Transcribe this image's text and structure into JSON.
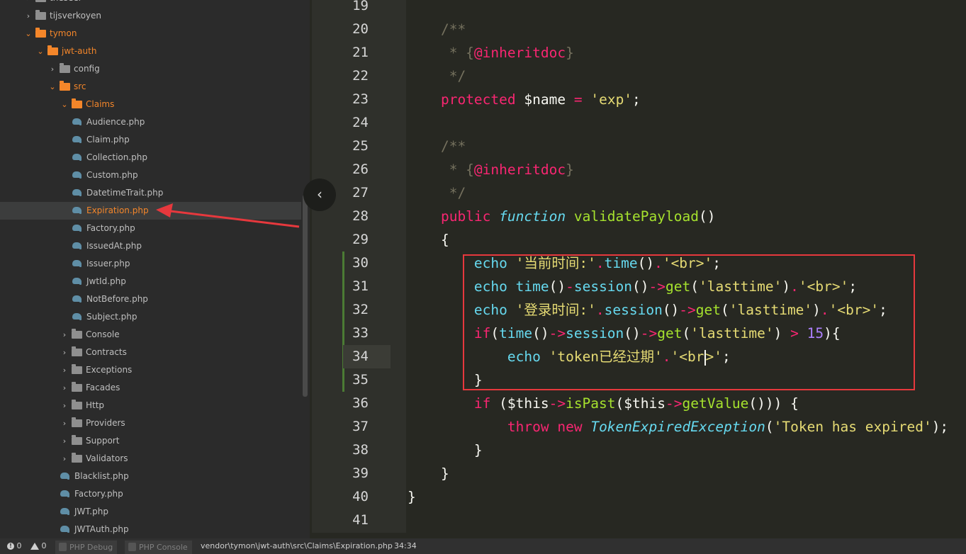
{
  "tree": [
    {
      "name": "theseer",
      "kind": "folder",
      "state": "closed",
      "depth": 1
    },
    {
      "name": "tijsverkoyen",
      "kind": "folder",
      "state": "closed",
      "depth": 1
    },
    {
      "name": "tymon",
      "kind": "folder",
      "state": "open",
      "depth": 1
    },
    {
      "name": "jwt-auth",
      "kind": "folder",
      "state": "open",
      "depth": 2
    },
    {
      "name": "config",
      "kind": "folder",
      "state": "closed",
      "depth": 3
    },
    {
      "name": "src",
      "kind": "folder",
      "state": "open",
      "depth": 3
    },
    {
      "name": "Claims",
      "kind": "folder",
      "state": "open",
      "depth": 4
    },
    {
      "name": "Audience.php",
      "kind": "file",
      "depth": 5
    },
    {
      "name": "Claim.php",
      "kind": "file",
      "depth": 5
    },
    {
      "name": "Collection.php",
      "kind": "file",
      "depth": 5
    },
    {
      "name": "Custom.php",
      "kind": "file",
      "depth": 5
    },
    {
      "name": "DatetimeTrait.php",
      "kind": "file",
      "depth": 5
    },
    {
      "name": "Expiration.php",
      "kind": "file",
      "depth": 5,
      "selected": true
    },
    {
      "name": "Factory.php",
      "kind": "file",
      "depth": 5
    },
    {
      "name": "IssuedAt.php",
      "kind": "file",
      "depth": 5
    },
    {
      "name": "Issuer.php",
      "kind": "file",
      "depth": 5
    },
    {
      "name": "JwtId.php",
      "kind": "file",
      "depth": 5
    },
    {
      "name": "NotBefore.php",
      "kind": "file",
      "depth": 5
    },
    {
      "name": "Subject.php",
      "kind": "file",
      "depth": 5
    },
    {
      "name": "Console",
      "kind": "folder",
      "state": "closed",
      "depth": 4
    },
    {
      "name": "Contracts",
      "kind": "folder",
      "state": "closed",
      "depth": 4
    },
    {
      "name": "Exceptions",
      "kind": "folder",
      "state": "closed",
      "depth": 4
    },
    {
      "name": "Facades",
      "kind": "folder",
      "state": "closed",
      "depth": 4
    },
    {
      "name": "Http",
      "kind": "folder",
      "state": "closed",
      "depth": 4
    },
    {
      "name": "Providers",
      "kind": "folder",
      "state": "closed",
      "depth": 4
    },
    {
      "name": "Support",
      "kind": "folder",
      "state": "closed",
      "depth": 4
    },
    {
      "name": "Validators",
      "kind": "folder",
      "state": "closed",
      "depth": 4
    },
    {
      "name": "Blacklist.php",
      "kind": "file",
      "depth": 4
    },
    {
      "name": "Factory.php",
      "kind": "file",
      "depth": 4
    },
    {
      "name": "JWT.php",
      "kind": "file",
      "depth": 4
    },
    {
      "name": "JWTAuth.php",
      "kind": "file",
      "depth": 4
    }
  ],
  "editor": {
    "collapse_icon": "chevron-left-icon",
    "first_line_number": 19,
    "lines": [
      [],
      [
        [
          "    ",
          ""
        ],
        [
          "/**",
          "cm"
        ]
      ],
      [
        [
          "     * {",
          "cm"
        ],
        [
          "@inheritdoc",
          "kw"
        ],
        [
          "}",
          "cm"
        ]
      ],
      [
        [
          "     */",
          "cm"
        ]
      ],
      [
        [
          "    ",
          ""
        ],
        [
          "protected",
          "kw"
        ],
        [
          " ",
          ""
        ],
        [
          "$name",
          "va"
        ],
        [
          " ",
          ""
        ],
        [
          "=",
          "kw"
        ],
        [
          " ",
          ""
        ],
        [
          "'exp'",
          "st"
        ],
        [
          ";",
          ""
        ]
      ],
      [],
      [
        [
          "    ",
          ""
        ],
        [
          "/**",
          "cm"
        ]
      ],
      [
        [
          "     * {",
          "cm"
        ],
        [
          "@inheritdoc",
          "kw"
        ],
        [
          "}",
          "cm"
        ]
      ],
      [
        [
          "     */",
          "cm"
        ]
      ],
      [
        [
          "    ",
          ""
        ],
        [
          "public",
          "kw"
        ],
        [
          " ",
          ""
        ],
        [
          "function",
          "fnk"
        ],
        [
          " ",
          ""
        ],
        [
          "validatePayload",
          "fn"
        ],
        [
          "()",
          ""
        ]
      ],
      [
        [
          "    {",
          ""
        ]
      ],
      [
        [
          "        ",
          ""
        ],
        [
          "echo",
          "ec"
        ],
        [
          " ",
          ""
        ],
        [
          "'当前时间:'",
          "st"
        ],
        [
          ".",
          "kw"
        ],
        [
          "time",
          "ec"
        ],
        [
          "()",
          ""
        ],
        [
          ".",
          "kw"
        ],
        [
          "'<br>'",
          "st"
        ],
        [
          ";",
          ""
        ]
      ],
      [
        [
          "        ",
          ""
        ],
        [
          "echo",
          "ec"
        ],
        [
          " ",
          ""
        ],
        [
          "time",
          "ec"
        ],
        [
          "()",
          ""
        ],
        [
          "-",
          "kw"
        ],
        [
          "session",
          "ec"
        ],
        [
          "()",
          ""
        ],
        [
          "->",
          "kw"
        ],
        [
          "get",
          "fn"
        ],
        [
          "(",
          ""
        ],
        [
          "'lasttime'",
          "st"
        ],
        [
          ")",
          ""
        ],
        [
          ".",
          "kw"
        ],
        [
          "'<br>'",
          "st"
        ],
        [
          ";",
          ""
        ]
      ],
      [
        [
          "        ",
          ""
        ],
        [
          "echo",
          "ec"
        ],
        [
          " ",
          ""
        ],
        [
          "'登录时间:'",
          "st"
        ],
        [
          ".",
          "kw"
        ],
        [
          "session",
          "ec"
        ],
        [
          "()",
          ""
        ],
        [
          "->",
          "kw"
        ],
        [
          "get",
          "fn"
        ],
        [
          "(",
          ""
        ],
        [
          "'lasttime'",
          "st"
        ],
        [
          ")",
          ""
        ],
        [
          ".",
          "kw"
        ],
        [
          "'<br>'",
          "st"
        ],
        [
          ";",
          ""
        ]
      ],
      [
        [
          "        ",
          ""
        ],
        [
          "if",
          "kw"
        ],
        [
          "(",
          ""
        ],
        [
          "time",
          "ec"
        ],
        [
          "()",
          ""
        ],
        [
          "->",
          "kw"
        ],
        [
          "session",
          "ec"
        ],
        [
          "()",
          ""
        ],
        [
          "->",
          "kw"
        ],
        [
          "get",
          "fn"
        ],
        [
          "(",
          ""
        ],
        [
          "'lasttime'",
          "st"
        ],
        [
          ") ",
          ""
        ],
        [
          ">",
          "kw"
        ],
        [
          " ",
          ""
        ],
        [
          "15",
          "nu"
        ],
        [
          "){",
          ""
        ]
      ],
      [
        [
          "            ",
          ""
        ],
        [
          "echo",
          "ec"
        ],
        [
          " ",
          ""
        ],
        [
          "'token已经过期'",
          "st"
        ],
        [
          ".",
          "kw"
        ],
        [
          "'<br",
          "st"
        ],
        [
          "|",
          "cursor"
        ],
        [
          ">'",
          "st"
        ],
        [
          ";",
          ""
        ]
      ],
      [
        [
          "        }",
          ""
        ]
      ],
      [
        [
          "        ",
          ""
        ],
        [
          "if",
          "kw"
        ],
        [
          " (",
          ""
        ],
        [
          "$this",
          "va"
        ],
        [
          "->",
          "kw"
        ],
        [
          "isPast",
          "fn"
        ],
        [
          "(",
          ""
        ],
        [
          "$this",
          "va"
        ],
        [
          "->",
          "kw"
        ],
        [
          "getValue",
          "fn"
        ],
        [
          "())) {",
          ""
        ]
      ],
      [
        [
          "            ",
          ""
        ],
        [
          "throw",
          "kw"
        ],
        [
          " ",
          ""
        ],
        [
          "new",
          "kw"
        ],
        [
          " ",
          ""
        ],
        [
          "TokenExpiredException",
          "cls"
        ],
        [
          "(",
          ""
        ],
        [
          "'Token has expired'",
          "st"
        ],
        [
          ");",
          ""
        ]
      ],
      [
        [
          "        }",
          ""
        ]
      ],
      [
        [
          "    }",
          ""
        ]
      ],
      [
        [
          "}",
          ""
        ]
      ],
      []
    ]
  },
  "status": {
    "info_icon": "info-icon",
    "errors": "0",
    "warning_icon": "warning-icon",
    "warnings": "0",
    "tab1": "PHP Debug",
    "tab2": "PHP Console",
    "path": "vendor\\tymon\\jwt-auth\\src\\Claims\\Expiration.php",
    "cursor": "34:34"
  },
  "colors": {
    "annotation_red": "#e6383d",
    "selected_file": "#f4862a",
    "git_modified": "#4b7b34"
  }
}
